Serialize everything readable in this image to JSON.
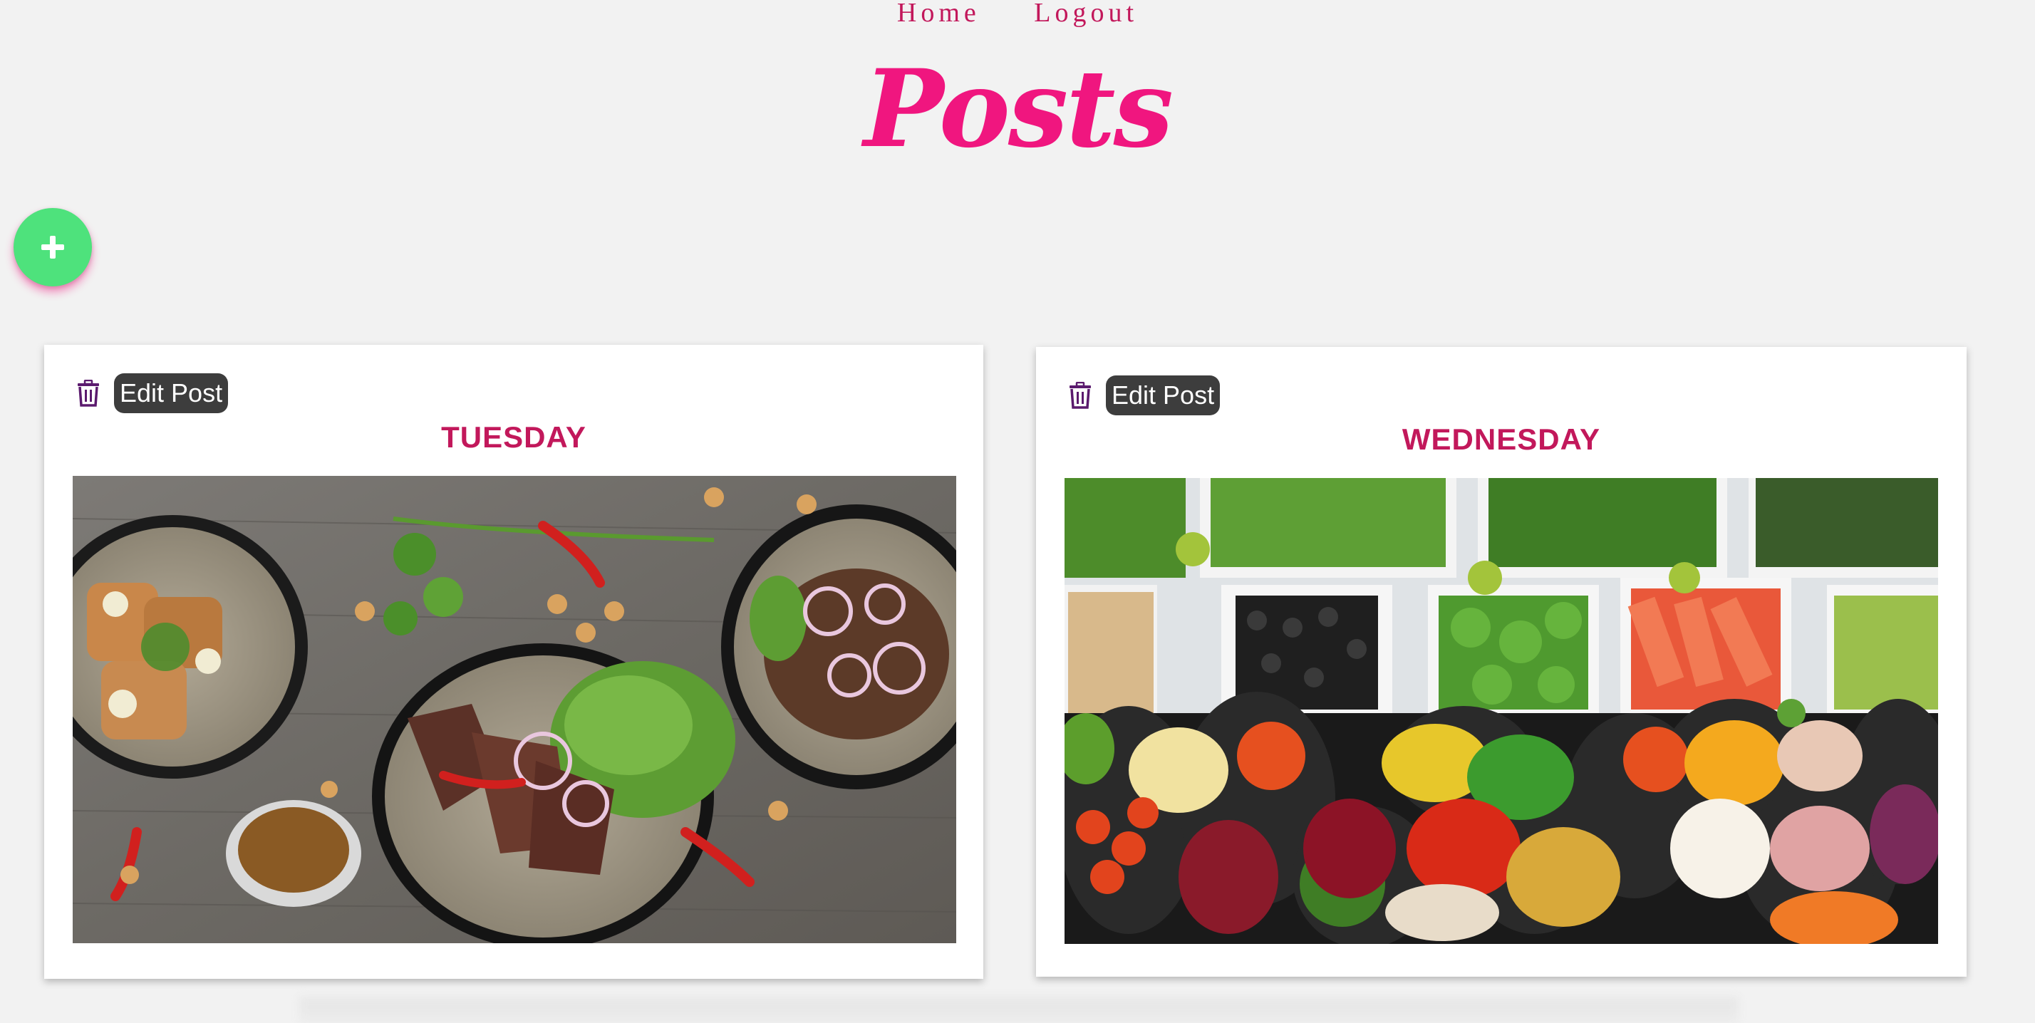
{
  "nav": {
    "items": [
      {
        "label": "Home"
      },
      {
        "label": "Logout"
      }
    ]
  },
  "page": {
    "title": "Posts"
  },
  "fab": {
    "icon": "plus-icon",
    "color": "#4ee27c"
  },
  "posts": [
    {
      "day": "TUESDAY",
      "edit_label": "Edit Post",
      "delete_icon": "trash-icon",
      "image_desc_icon": "food-photo"
    },
    {
      "day": "WEDNESDAY",
      "edit_label": "Edit Post",
      "delete_icon": "trash-icon",
      "image_desc_icon": "salad-bar-photo"
    }
  ],
  "colors": {
    "accent": "#f0167f",
    "day_title": "#c2185b",
    "edit_button_bg": "#3d3d3d",
    "trash_icon": "#5b1a6e",
    "background": "#f2f2f2"
  }
}
